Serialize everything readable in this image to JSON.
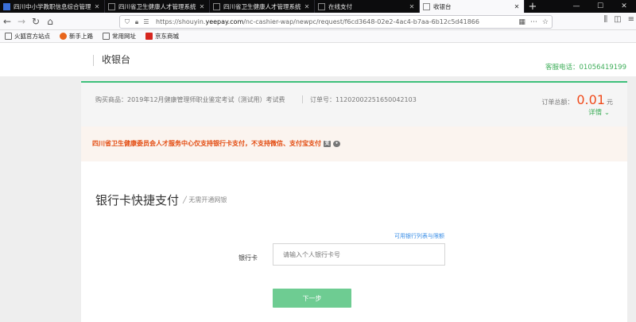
{
  "browser": {
    "tabs": [
      {
        "title": "四川中小学教职信息综合管理",
        "active": false,
        "favicon_color": "#3a6fd8"
      },
      {
        "title": "四川省卫生健康人才管理系统",
        "active": false,
        "favicon_color": "#4a4a4a"
      },
      {
        "title": "四川省卫生健康人才管理系统",
        "active": false,
        "favicon_color": "#4a4a4a"
      },
      {
        "title": "在线支付",
        "active": false,
        "favicon_color": "#4a4a4a"
      },
      {
        "title": "收银台",
        "active": true,
        "favicon_color": "#4a4a4a"
      }
    ],
    "url_prefix": "https://shouyin.",
    "url_domain": "yeepay.com",
    "url_path": "/nc-cashier-wap/newpc/request/f6cd3648-02e2-4ac4-b7aa-6b12c5d41866",
    "bookmarks": [
      {
        "label": "火狐官方站点",
        "color": "#666"
      },
      {
        "label": "新手上路",
        "color": "#e8661c"
      },
      {
        "label": "常用网址",
        "color": "#666"
      },
      {
        "label": "京东商城",
        "color": "#d6261f"
      }
    ]
  },
  "header": {
    "title": "收银台",
    "service_phone": "客服电话：01056419199"
  },
  "order": {
    "product": "购买商品：2019年12月健康管理师职业鉴定考试（测试用）考试费",
    "order_no": "订单号：11202002251650042103",
    "total_label": "订单总额：",
    "amount": "0.01",
    "currency": "元",
    "detail": "详情 ⌄"
  },
  "notice": {
    "text": "四川省卫生健康委员会人才服务中心仅支持银行卡支付，不支持微信、支付宝支付"
  },
  "payment": {
    "title": "银行卡快捷支付",
    "subtitle": "╱ 无需开通网银",
    "bank_list_link": "可用银行列表与限额",
    "bank_label": "银行卡",
    "bank_placeholder": "请输入个人银行卡号",
    "next_button": "下一步"
  },
  "colors": {
    "accent_green": "#3ec07b",
    "amount_red": "#f04a1a",
    "notice_orange": "#e34b10",
    "link_blue": "#3a8ee6",
    "button_green": "#6ecc92"
  }
}
